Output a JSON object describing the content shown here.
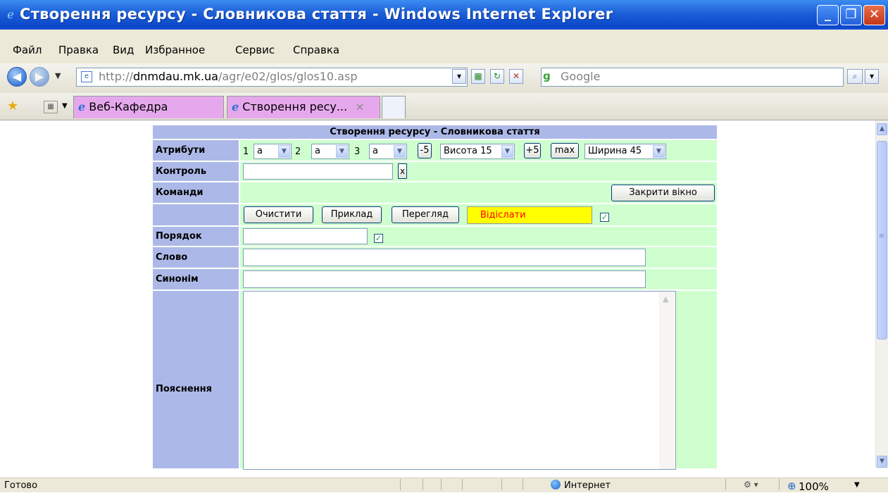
{
  "window": {
    "title": "Створення ресурсу - Словникова стаття - Windows Internet Explorer"
  },
  "menu": [
    "Файл",
    "Правка",
    "Вид",
    "Избранное",
    "Сервис",
    "Справка"
  ],
  "address": {
    "protocol": "http://",
    "host": "dnmdau.mk.ua",
    "path": "/agr/e02/glos/glos10.asp"
  },
  "search": {
    "placeholder": "Google"
  },
  "tabs": [
    {
      "label": "Веб-Кафедра"
    },
    {
      "label": "Створення ресу...",
      "close": "×"
    }
  ],
  "form": {
    "header": "Створення ресурсу - Словникова стаття",
    "labels": {
      "attributes": "Атрибути",
      "control": "Контроль",
      "commands": "Команди",
      "order": "Порядок",
      "word": "Слово",
      "synonym": "Синонім",
      "explanation": "Пояснення"
    },
    "attr_nums": [
      "1",
      "2",
      "3"
    ],
    "attr_values": [
      "a",
      "a",
      "a"
    ],
    "minus5": "-5",
    "plus5": "+5",
    "max": "max",
    "height_select": "Висота 15",
    "width_select": "Ширина 45",
    "control_clear": "x",
    "close_window": "Закрити вікно",
    "buttons": {
      "clear": "Очистити",
      "example": "Приклад",
      "preview": "Перегляд",
      "send": "Відіслати"
    },
    "control_value": "",
    "order_value": "",
    "word_value": "",
    "synonym_value": "",
    "explanation_value": ""
  },
  "status": {
    "left": "Готово",
    "zone": "Интернет",
    "zoom": "100%"
  },
  "colors": {
    "label_bg": "#acb9e8",
    "cell_bg": "#cfffcf",
    "send_bg": "#ffff00",
    "send_text": "#ff0000",
    "titlebar": "#0a47c9"
  }
}
